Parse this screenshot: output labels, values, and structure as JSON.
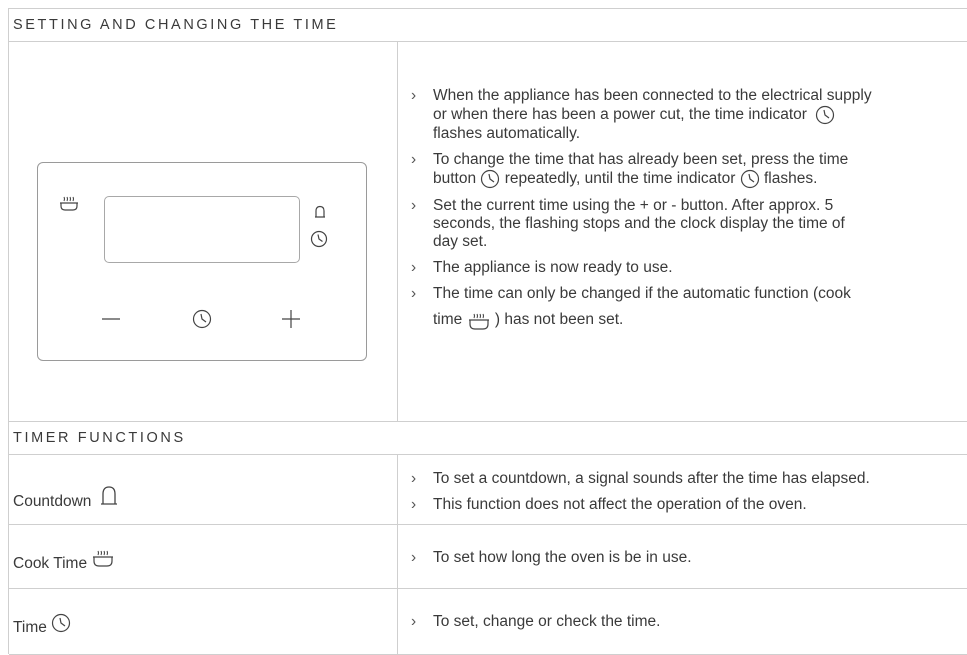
{
  "section1": {
    "title": "SETTING AND CHANGING THE TIME",
    "bullets": [
      [
        "When the appliance has been connected to the electrical supply",
        "or when there has been a power cut, the time indicator",
        "flashes automatically."
      ],
      [
        "To change the time that has already been set, press the time",
        "button",
        "repeatedly, until the time indicator",
        "flashes."
      ],
      [
        "Set the current time using the + or - button. After approx. 5",
        "seconds, the flashing stops and the clock display the time of",
        "day set."
      ],
      [
        "The appliance is now ready to use."
      ],
      [
        "The time can only be changed if the automatic function (cook",
        "time",
        ") has not been set."
      ]
    ],
    "panel": {
      "minus": "—",
      "plus": "+"
    }
  },
  "section2": {
    "title": "TIMER FUNCTIONS",
    "rows": [
      {
        "label": "Countdown",
        "bullets": [
          "To set a countdown, a signal sounds after the time has elapsed.",
          "This function does not affect the operation of the oven."
        ]
      },
      {
        "label": "Cook Time",
        "bullets": [
          "To set how long the oven is be in use."
        ]
      },
      {
        "label": "Time",
        "bullets": [
          "To set, change or check the time."
        ]
      }
    ]
  },
  "bullet_mark": "›"
}
